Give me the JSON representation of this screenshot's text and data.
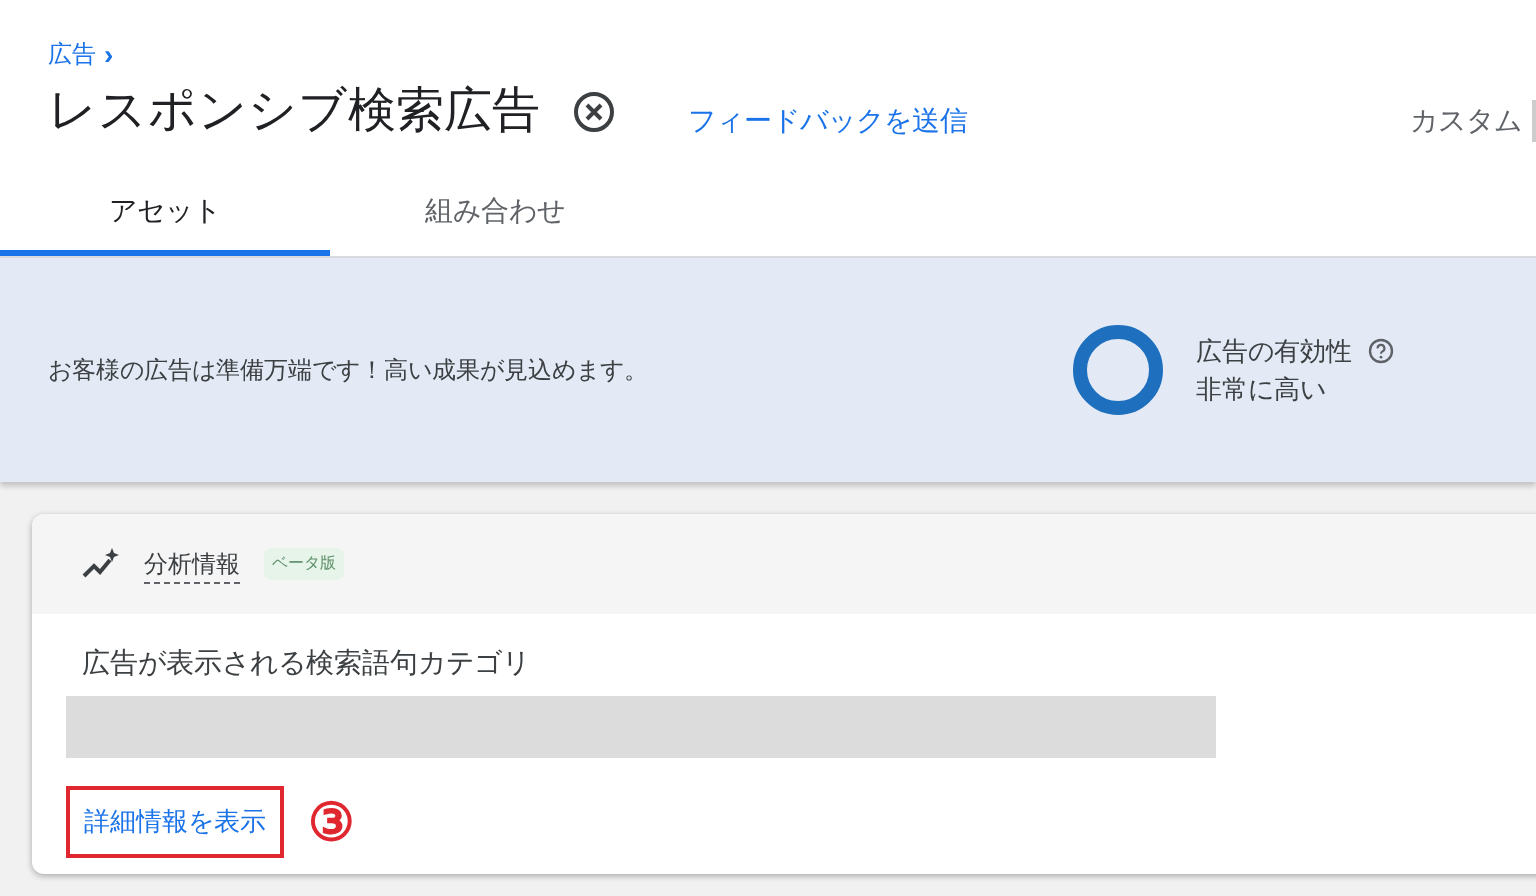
{
  "breadcrumb": {
    "label": "広告",
    "chevron": "›"
  },
  "title": "レスポンシブ検索広告",
  "feedback_link": "フィードバックを送信",
  "view_selector": {
    "label": "カスタム"
  },
  "tabs": [
    {
      "label": "アセット",
      "selected": true
    },
    {
      "label": "組み合わせ",
      "selected": false
    }
  ],
  "banner": {
    "message": "お客様の広告は準備万端です！高い成果が見込めます。",
    "effectiveness": {
      "label": "広告の有効性",
      "value": "非常に高い"
    }
  },
  "insights_card": {
    "title": "分析情報",
    "badge": "ベータ版",
    "section_title": "広告が表示される検索語句カテゴリ",
    "details_link": {
      "label": "詳細情報を表示",
      "highlighted": true
    },
    "annotation": "③"
  }
}
